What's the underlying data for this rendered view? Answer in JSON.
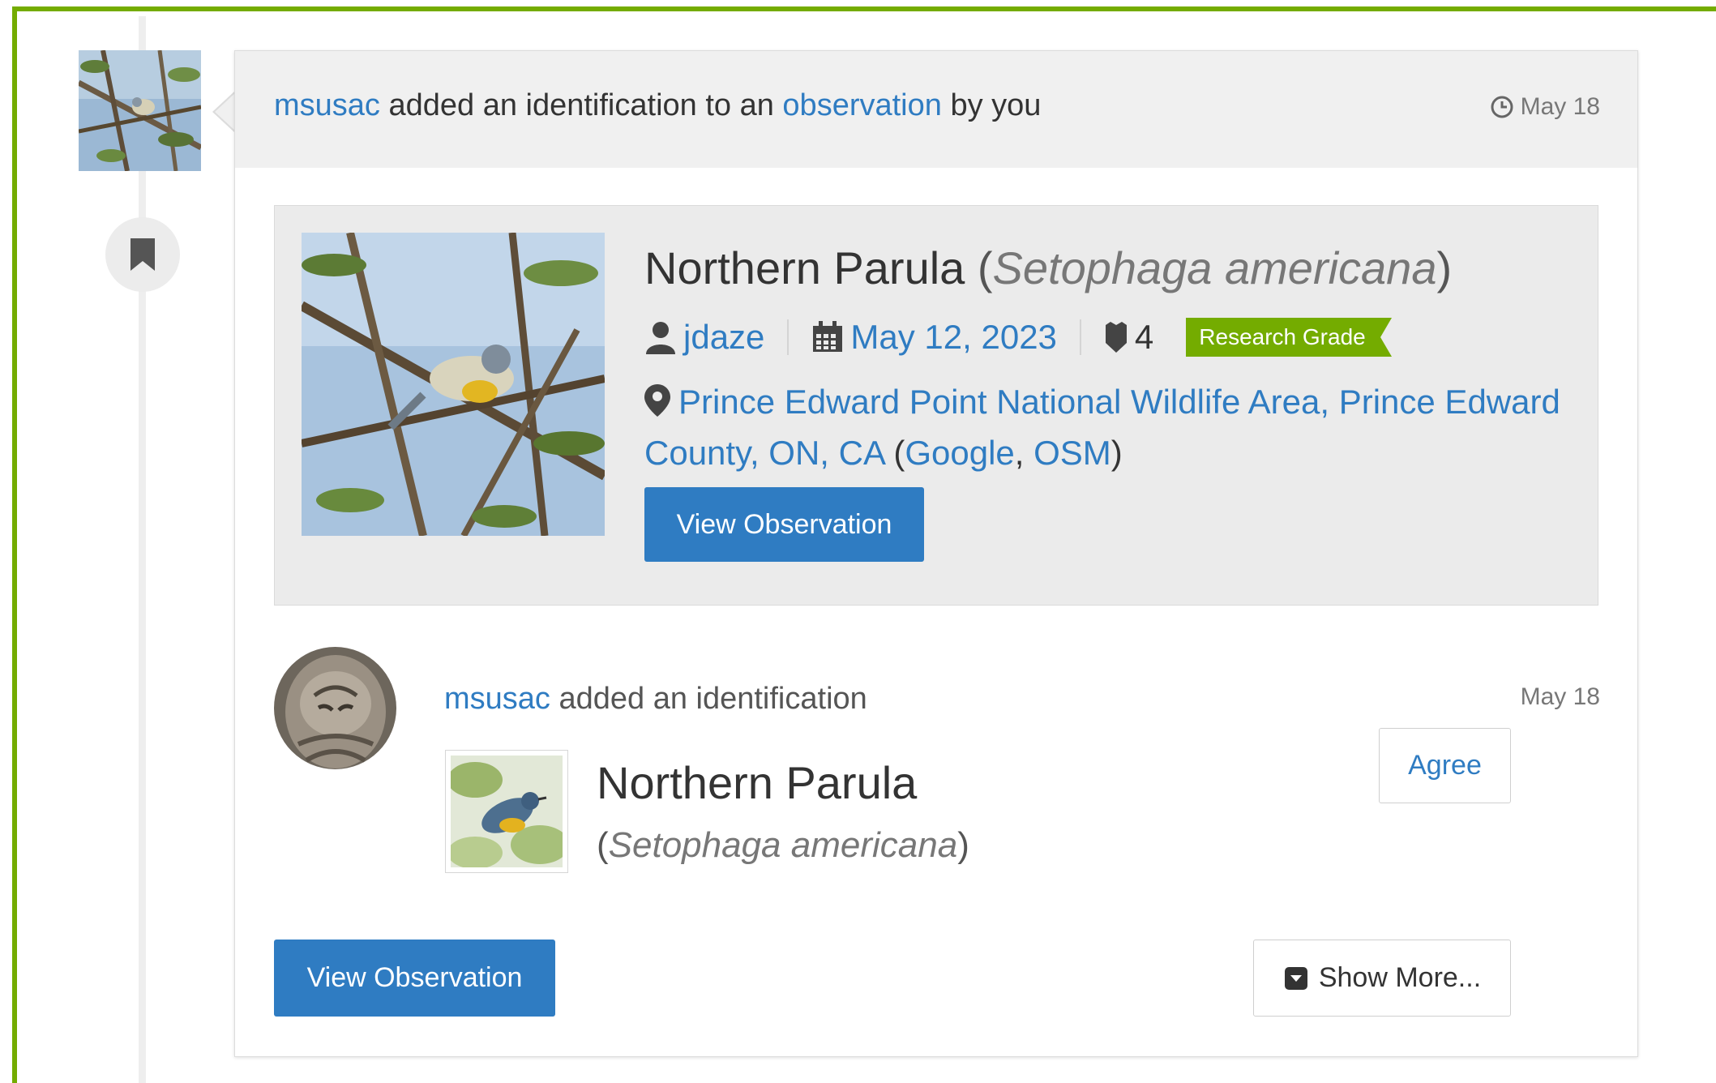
{
  "colors": {
    "accent_green": "#74ac00",
    "link_blue": "#2f7cc2",
    "button_blue": "#2f7cc2"
  },
  "header": {
    "user": "msusac",
    "text_mid": " added an identification to an ",
    "observation_link": "observation",
    "text_end": " by you",
    "date": "May 18",
    "date_icon": "clock-icon"
  },
  "observation": {
    "common_name": "Northern Parula",
    "scientific_name": "Setophaga americana",
    "observer": "jdaze",
    "observed_date": "May 12, 2023",
    "id_count": "4",
    "quality_grade": "Research Grade",
    "place": "Prince Edward Point National Wildlife Area, Prince Edward County, ON, CA",
    "map_links": [
      "Google",
      "OSM"
    ],
    "view_button": "View Observation"
  },
  "identification": {
    "user": "msusac",
    "action": " added an identification",
    "date": "May 18",
    "common_name": "Northern Parula",
    "scientific_name": "Setophaga americana",
    "agree_button": "Agree"
  },
  "footer": {
    "view_button": "View Observation",
    "show_more_button": "Show More..."
  }
}
